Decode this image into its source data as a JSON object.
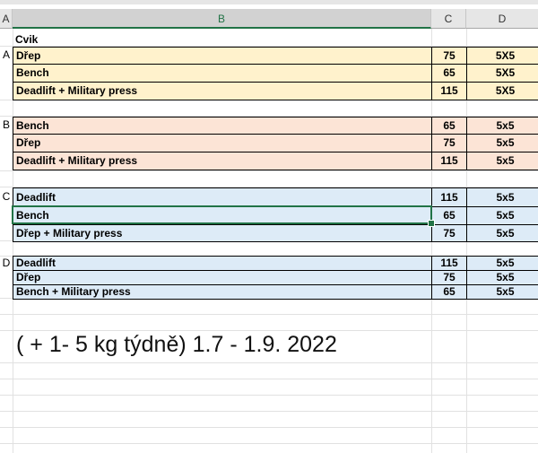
{
  "columns": {
    "a": "A",
    "b": "B",
    "c": "C",
    "d": "D"
  },
  "header_label": "Cvik",
  "colors": {
    "yellow": "#fff2cc",
    "orange": "#fce4d6",
    "blue": "#ddebf7",
    "select_green": "#217346"
  },
  "groups": [
    {
      "label": "A",
      "rows": [
        {
          "name": "Dřep",
          "weight": "75",
          "sets": "5X5"
        },
        {
          "name": "Bench",
          "weight": "65",
          "sets": "5X5"
        },
        {
          "name": "Deadlift + Military press",
          "weight": "115",
          "sets": "5X5"
        }
      ]
    },
    {
      "label": "B",
      "rows": [
        {
          "name": "Bench",
          "weight": "65",
          "sets": "5x5"
        },
        {
          "name": "Dřep",
          "weight": "75",
          "sets": "5x5"
        },
        {
          "name": "Deadlift + Military press",
          "weight": "115",
          "sets": "5x5"
        }
      ]
    },
    {
      "label": "C",
      "rows": [
        {
          "name": "Deadlift",
          "weight": "115",
          "sets": "5x5"
        },
        {
          "name": "Bench",
          "weight": "65",
          "sets": "5x5"
        },
        {
          "name": "Dřep + Military press",
          "weight": "75",
          "sets": "5x5"
        }
      ]
    },
    {
      "label": "D",
      "rows": [
        {
          "name": "Deadlift",
          "weight": "115",
          "sets": "5x5"
        },
        {
          "name": "Dřep",
          "weight": "75",
          "sets": "5x5"
        },
        {
          "name": "Bench + Military press",
          "weight": "65",
          "sets": "5x5"
        }
      ]
    }
  ],
  "note": "( + 1- 5 kg týdně) 1.7 - 1.9. 2022"
}
